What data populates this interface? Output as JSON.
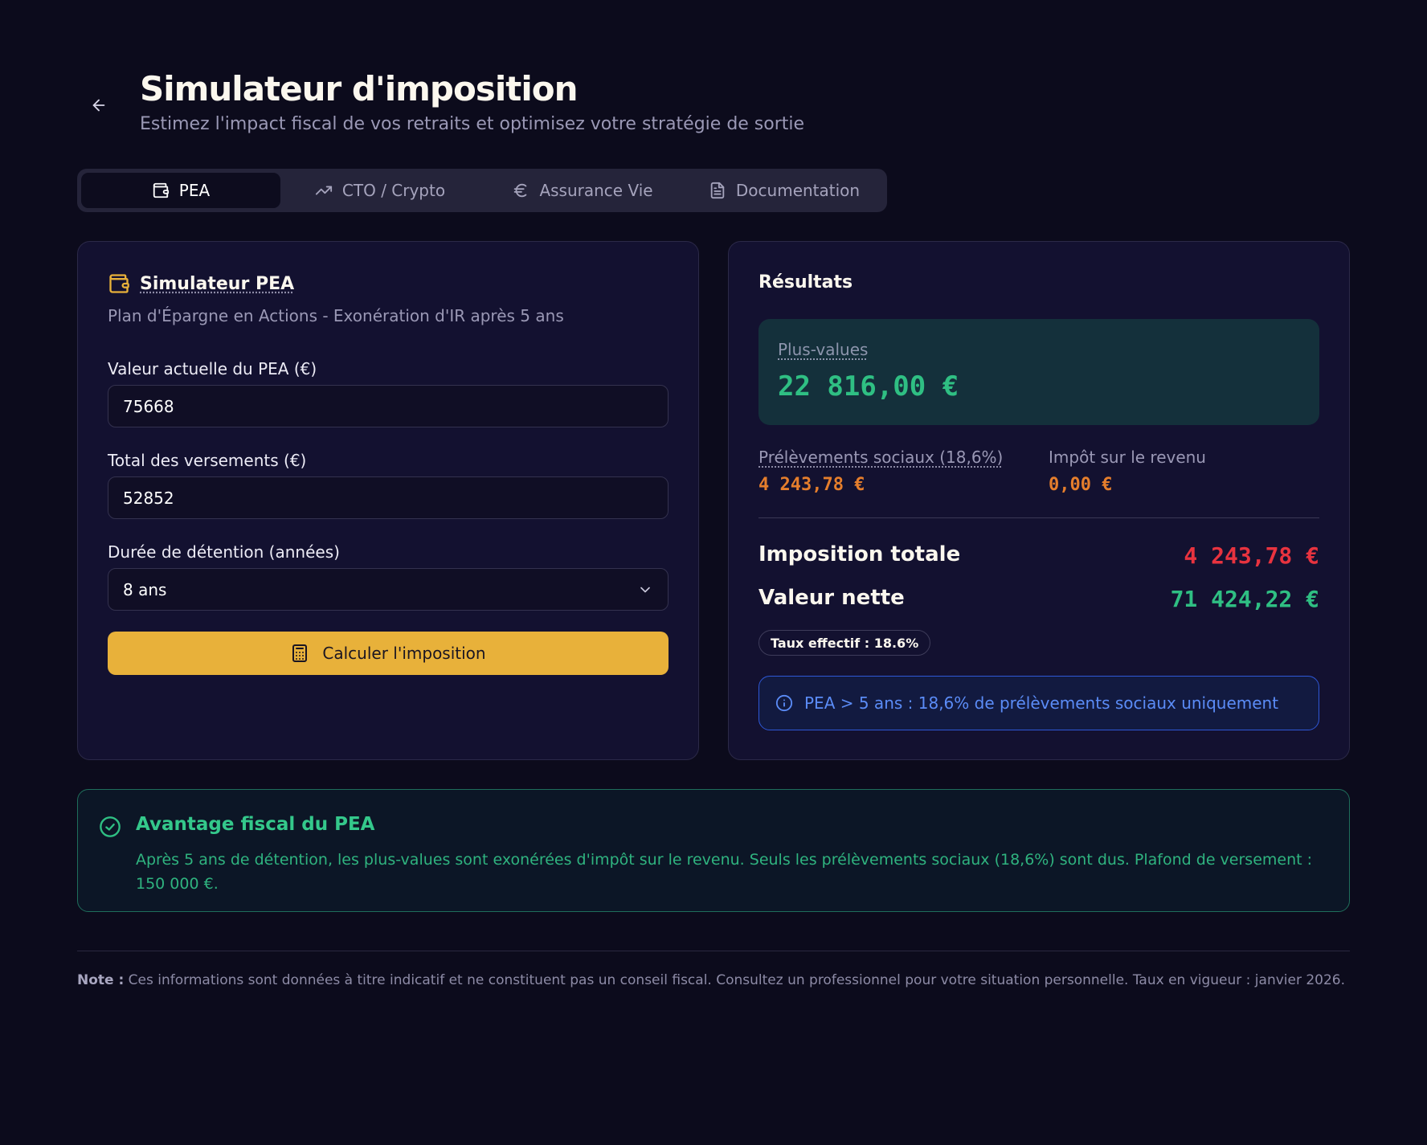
{
  "header": {
    "title": "Simulateur d'imposition",
    "subtitle": "Estimez l'impact fiscal de vos retraits et optimisez votre stratégie de sortie"
  },
  "tabs": [
    {
      "label": "PEA",
      "icon": "wallet-icon",
      "active": true
    },
    {
      "label": "CTO / Crypto",
      "icon": "trending-up-icon",
      "active": false
    },
    {
      "label": "Assurance Vie",
      "icon": "euro-icon",
      "active": false
    },
    {
      "label": "Documentation",
      "icon": "document-icon",
      "active": false
    }
  ],
  "simulator": {
    "title": "Simulateur PEA",
    "description": "Plan d'Épargne en Actions - Exonération d'IR après 5 ans",
    "fields": {
      "current_value": {
        "label": "Valeur actuelle du PEA (€)",
        "value": "75668"
      },
      "total_deposits": {
        "label": "Total des versements (€)",
        "value": "52852"
      },
      "holding_duration": {
        "label": "Durée de détention (années)",
        "value": "8 ans"
      }
    },
    "calculate_label": "Calculer l'imposition"
  },
  "results": {
    "title": "Résultats",
    "gains_label": "Plus-values",
    "gains_value": "22 816,00 €",
    "social_label": "Prélèvements sociaux (18,6%)",
    "social_value": "4 243,78 €",
    "income_tax_label": "Impôt sur le revenu",
    "income_tax_value": "0,00 €",
    "total_tax_label": "Imposition totale",
    "total_tax_value": "4 243,78 €",
    "net_value_label": "Valeur nette",
    "net_value": "71 424,22 €",
    "effective_rate": "Taux effectif : 18.6%",
    "info": "PEA > 5 ans : 18,6% de prélèvements sociaux uniquement"
  },
  "advantage": {
    "title": "Avantage fiscal du PEA",
    "text": "Après 5 ans de détention, les plus-values sont exonérées d'impôt sur le revenu. Seuls les prélèvements sociaux (18,6%) sont dus. Plafond de versement : 150 000 €."
  },
  "footer": {
    "note_label": "Note :",
    "note_text": " Ces informations sont données à titre indicatif et ne constituent pas un conseil fiscal. Consultez un professionnel pour votre situation personnelle. Taux en vigueur : janvier 2026."
  },
  "colors": {
    "background": "#0c0b1c",
    "accent_button": "#e8b13a",
    "positive": "#2fbf83",
    "negative": "#e8333f",
    "warning": "#e57e2c",
    "info": "#5b8cf7"
  }
}
